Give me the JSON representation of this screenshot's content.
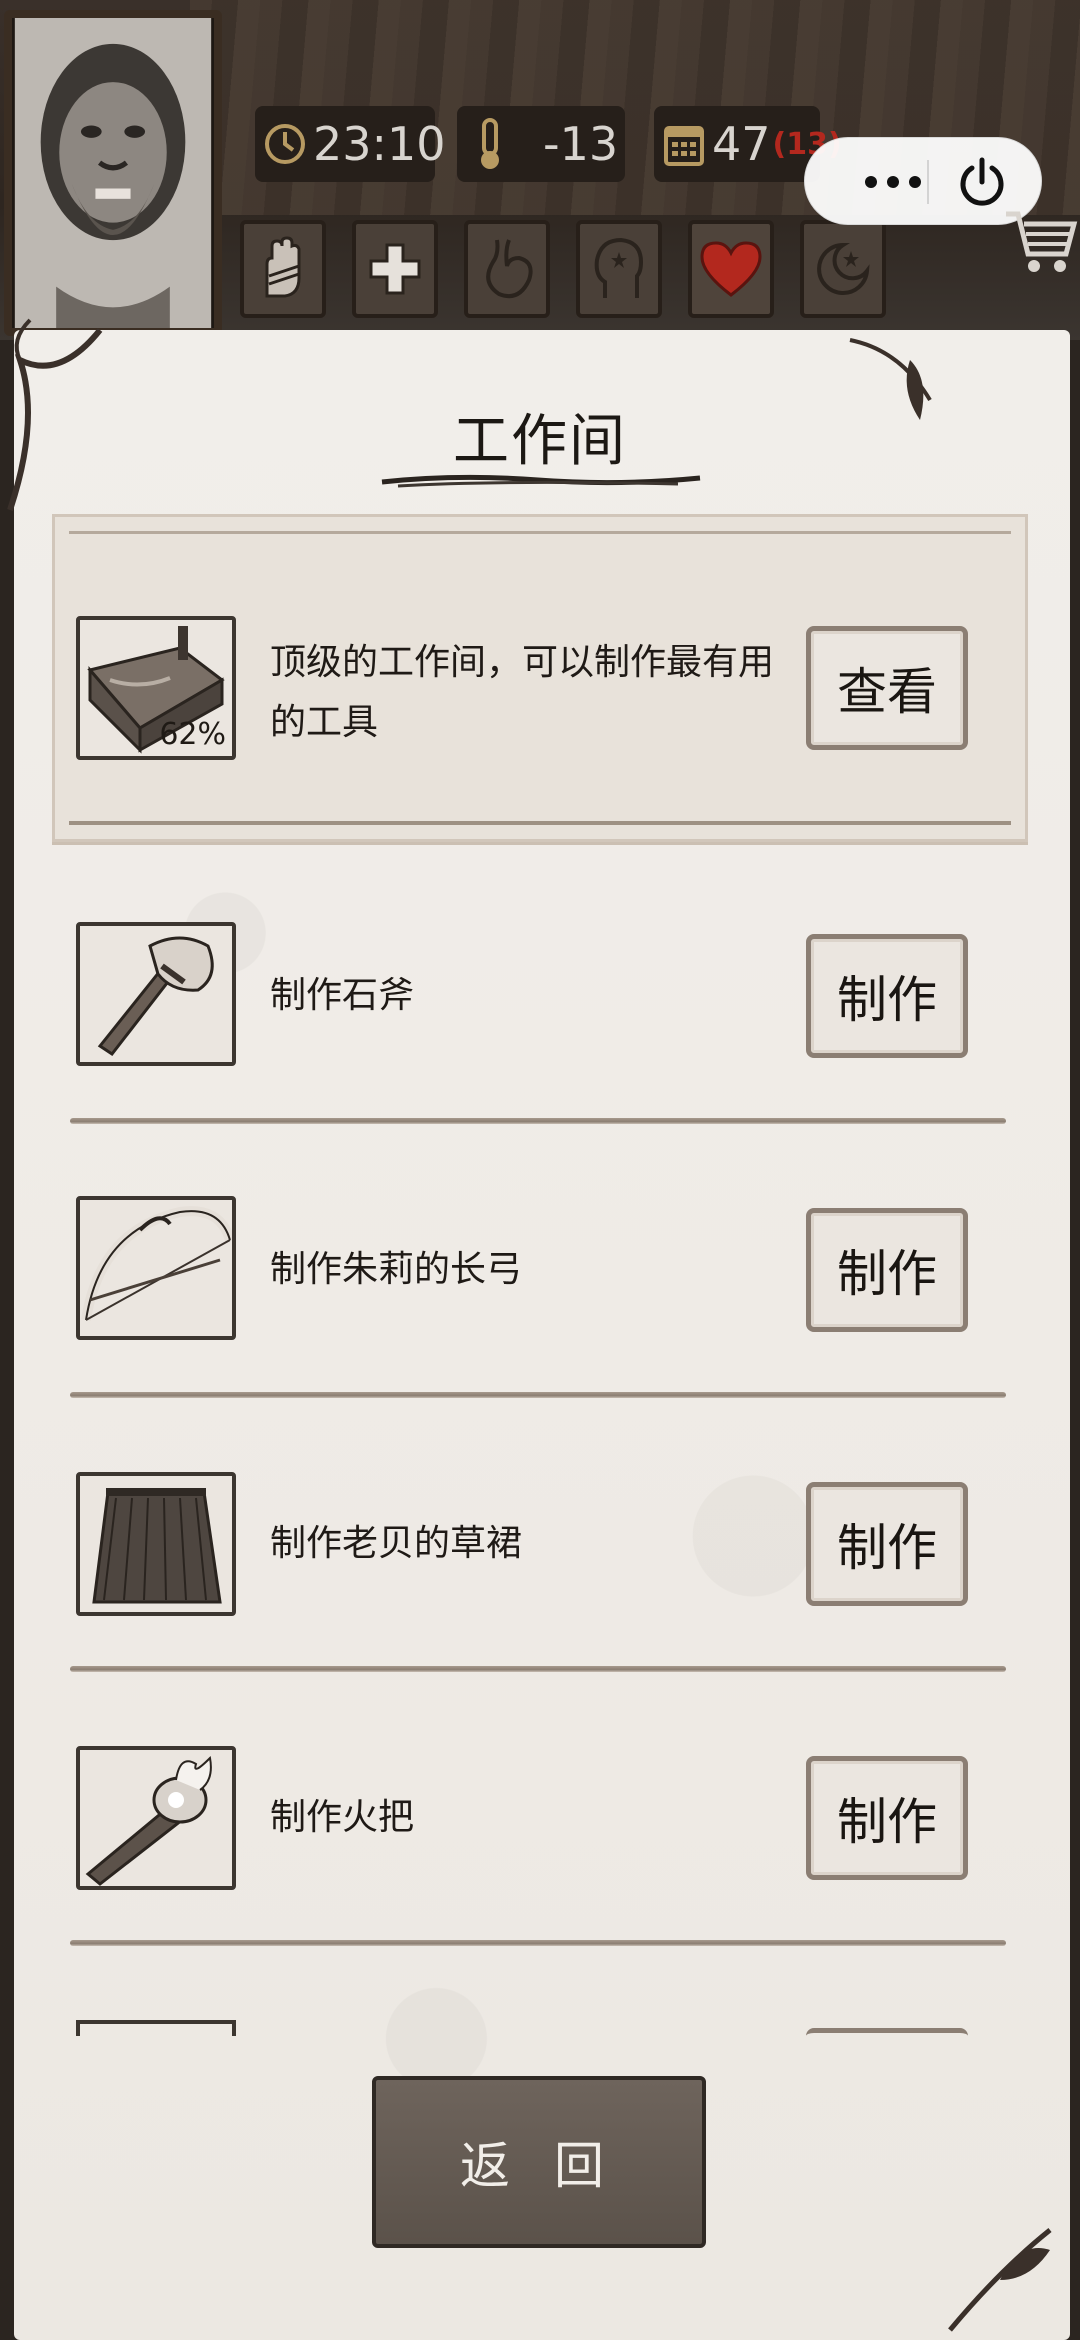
{
  "header": {
    "time": "23:10",
    "temperature": "-13",
    "day": "47",
    "day_extra": "(13)"
  },
  "status_icons": [
    "hand-icon",
    "health-cross-icon",
    "stomach-icon",
    "head-icon",
    "heart-icon",
    "moon-star-icon"
  ],
  "mini_program": {
    "more_icon": "more-dots-icon",
    "power_icon": "power-icon"
  },
  "panel": {
    "title": "工作间",
    "featured": {
      "description": "顶级的工作间，可以制作最有用的工具",
      "progress": "62%",
      "button": "查看"
    },
    "recipes": [
      {
        "label": "制作石斧",
        "button": "制作",
        "icon": "stone-axe-icon"
      },
      {
        "label": "制作朱莉的长弓",
        "button": "制作",
        "icon": "longbow-icon"
      },
      {
        "label": "制作老贝的草裙",
        "button": "制作",
        "icon": "grass-skirt-icon"
      },
      {
        "label": "制作火把",
        "button": "制作",
        "icon": "torch-icon"
      }
    ],
    "back_button": "返 回"
  },
  "colors": {
    "paper": "#efebe6",
    "button_border": "#8b7e73",
    "heart": "#b3281e",
    "back_button": "#655b53"
  }
}
